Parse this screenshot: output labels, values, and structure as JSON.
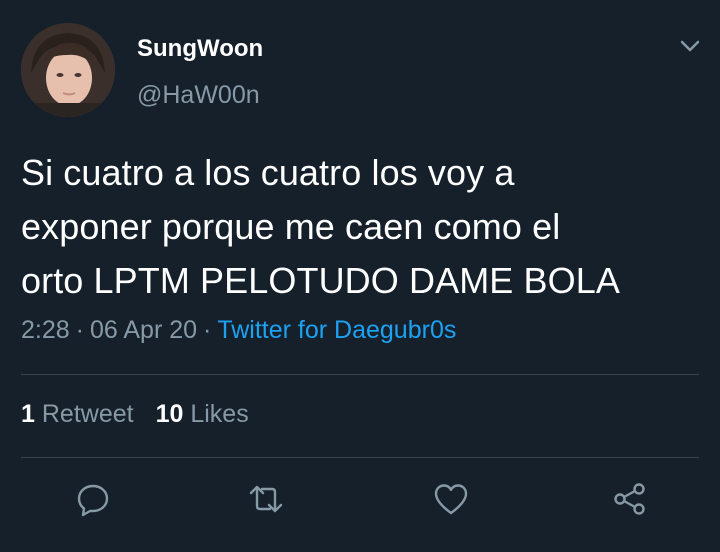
{
  "user": {
    "display_name": "SungWoon",
    "handle": "@HaW00n"
  },
  "tweet": {
    "text_lines": [
      "Si cuatro a los cuatro los voy a",
      "exponer porque me caen como el",
      "orto LPTM PELOTUDO DAME BOLA"
    ],
    "time": "2:28",
    "separator": "·",
    "date": "06 Apr 20",
    "source": "Twitter for Daegubr0s"
  },
  "stats": {
    "retweets_count": "1",
    "retweets_label": "Retweet",
    "likes_count": "10",
    "likes_label": "Likes"
  },
  "icons": {
    "menu": "chevron-down-icon",
    "reply": "reply-icon",
    "retweet": "retweet-icon",
    "like": "heart-icon",
    "share": "share-icon"
  },
  "colors": {
    "background": "#15202b",
    "primary_text": "#ffffff",
    "secondary_text": "#8899a6",
    "link": "#1da1f2",
    "divider": "#38444d"
  }
}
